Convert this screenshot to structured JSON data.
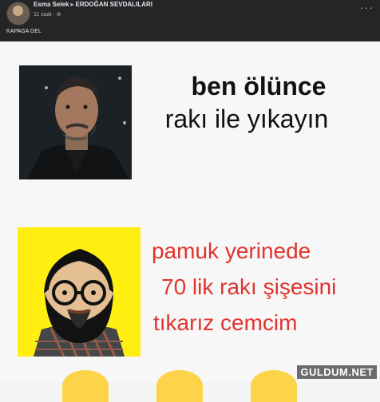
{
  "post": {
    "author": "Esma Selek",
    "group": "ERDOĞAN SEVDALILARI",
    "time": "11 saat",
    "caption": "KAPAGA GEL"
  },
  "meme": {
    "line1": "ben ölünce",
    "line2": "rakı ile yıkayın",
    "line3": "pamuk yerinede",
    "line4": "70 lik rakı şişesini",
    "line5": "tıkarız cemcim"
  },
  "watermark": "GULDUM.NET",
  "colors": {
    "header_bg": "#242526",
    "red_text": "#e0342f",
    "yellow_bg": "#ffef10"
  }
}
